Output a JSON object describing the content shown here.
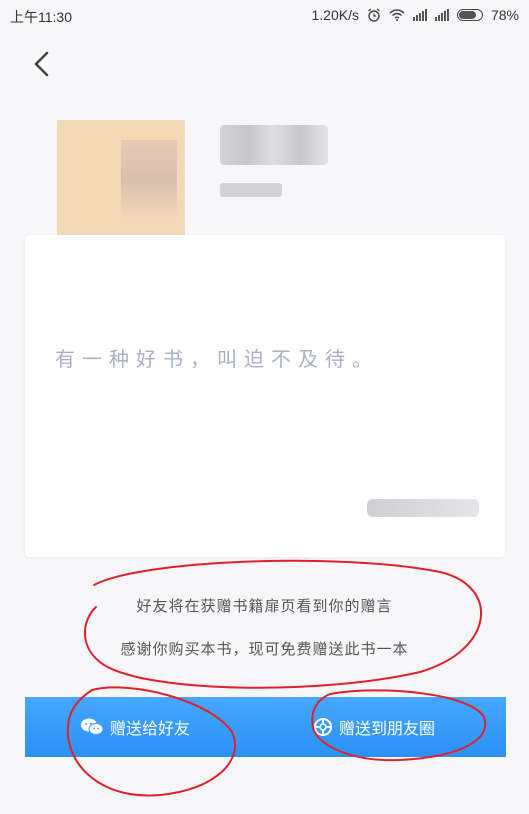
{
  "status_bar": {
    "time": "上午11:30",
    "network_speed": "1.20K/s",
    "battery": "78%",
    "battery_level": 0.78
  },
  "card": {
    "message": "有一种好书，叫迫不及待。"
  },
  "notice": {
    "line1": "好友将在获赠书籍扉页看到你的赠言",
    "line2": "感谢你购买本书，现可免费赠送此书一本"
  },
  "actions": {
    "gift_friend": "赠送给好友",
    "gift_moments": "赠送到朋友圈"
  },
  "colors": {
    "accent": "#3399ff",
    "annotation": "#e0202a"
  },
  "icons": {
    "back": "chevron-left-icon",
    "wechat": "wechat-icon",
    "moments": "moments-icon"
  }
}
